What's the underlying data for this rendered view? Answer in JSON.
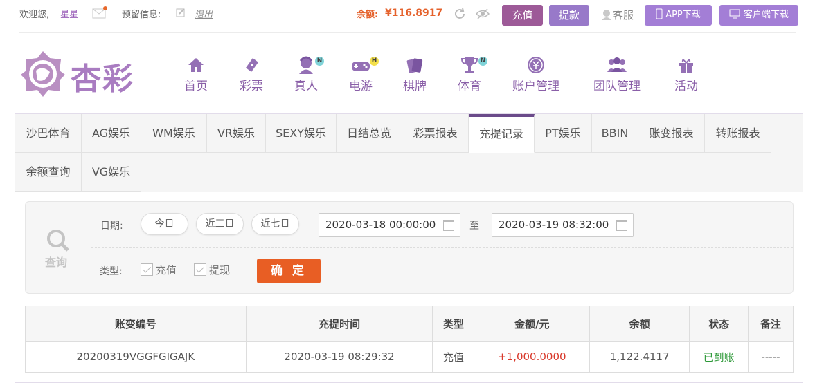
{
  "topbar": {
    "welcome": "欢迎您,",
    "username": "星星",
    "reserve_label": "预留信息:",
    "logout": "退出",
    "balance_label": "余额:",
    "balance_value": "¥116.8917",
    "recharge": "充值",
    "withdraw": "提款",
    "service": "客服",
    "app_download": "APP下载",
    "client_download": "客户端下载"
  },
  "nav": [
    {
      "label": "首页",
      "icon": "home-icon"
    },
    {
      "label": "彩票",
      "icon": "lottery-ticket-icon"
    },
    {
      "label": "真人",
      "icon": "live-dealer-icon",
      "badge": "N"
    },
    {
      "label": "电游",
      "icon": "gamepad-icon",
      "badge": "H"
    },
    {
      "label": "棋牌",
      "icon": "cards-icon"
    },
    {
      "label": "体育",
      "icon": "trophy-icon",
      "badge": "N"
    },
    {
      "label": "账户管理",
      "icon": "account-icon"
    },
    {
      "label": "团队管理",
      "icon": "team-icon"
    },
    {
      "label": "活动",
      "icon": "gift-icon"
    }
  ],
  "logo_text": "杏彩",
  "tabs": [
    "沙巴体育",
    "AG娱乐",
    "WM娱乐",
    "VR娱乐",
    "SEXY娱乐",
    "日结总览",
    "彩票报表",
    "充提记录",
    "PT娱乐",
    "BBIN",
    "账变报表",
    "转账报表",
    "余额查询",
    "VG娱乐"
  ],
  "active_tab": "充提记录",
  "search": {
    "label": "查询",
    "date_label": "日期:",
    "today": "今日",
    "three_days": "近三日",
    "seven_days": "近七日",
    "start_date": "2020-03-18 00:00:00",
    "to": "至",
    "end_date": "2020-03-19 08:32:00",
    "type_label": "类型:",
    "type_recharge": "充值",
    "type_withdraw": "提现",
    "confirm": "确 定"
  },
  "table": {
    "headers": [
      "账变编号",
      "充提时间",
      "类型",
      "金额/元",
      "余额",
      "状态",
      "备注"
    ],
    "rows": [
      [
        "20200319VGGFGIGAJK",
        "2020-03-19 08:29:32",
        "充值",
        "+1,000.0000",
        "1,122.4117",
        "已到账",
        "-----"
      ]
    ]
  },
  "colors": {
    "accent": "#9b6fc6",
    "orange": "#e85e24",
    "status_green": "#2f9a3a",
    "amount_red": "#d93a2c"
  }
}
